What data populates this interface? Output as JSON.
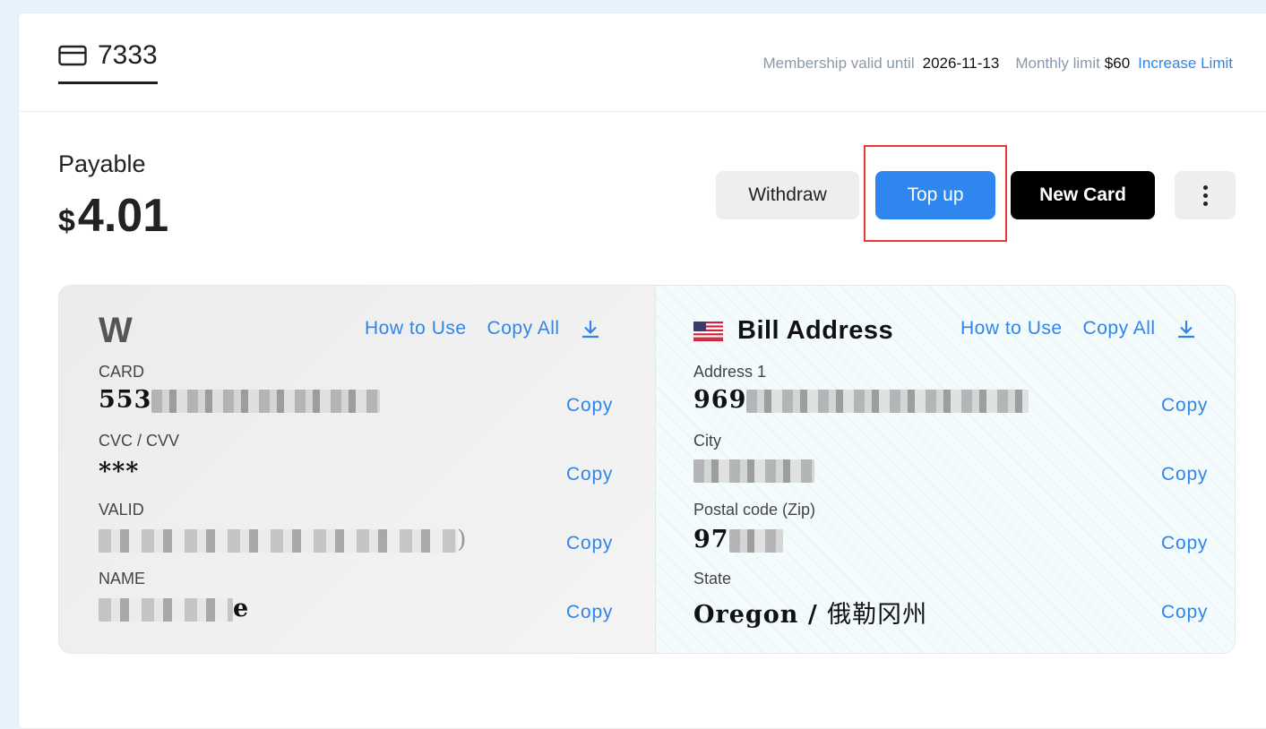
{
  "header": {
    "card_last4": "7333",
    "membership_label": "Membership valid until",
    "membership_date": "2026-11-13",
    "monthly_limit_label": "Monthly limit",
    "monthly_limit_value": "$60",
    "increase_limit_link": "Increase Limit"
  },
  "payable": {
    "label": "Payable",
    "currency": "$",
    "amount": "4.01"
  },
  "buttons": {
    "withdraw": "Withdraw",
    "top_up": "Top up",
    "new_card": "New Card"
  },
  "card_section": {
    "logo": "W",
    "how_to_use": "How to Use",
    "copy_all": "Copy All",
    "fields": [
      {
        "label": "CARD",
        "value": "553",
        "copy": "Copy"
      },
      {
        "label": "CVC / CVV",
        "value": "***",
        "copy": "Copy"
      },
      {
        "label": "VALID",
        "value": ")",
        "copy": "Copy"
      },
      {
        "label": "NAME",
        "value": "e",
        "copy": "Copy"
      }
    ]
  },
  "bill_section": {
    "title": "Bill Address",
    "how_to_use": "How to Use",
    "copy_all": "Copy All",
    "fields": [
      {
        "label": "Address 1",
        "value": "969",
        "copy": "Copy"
      },
      {
        "label": "City",
        "value": "",
        "copy": "Copy"
      },
      {
        "label": "Postal code (Zip)",
        "value": "97",
        "copy": "Copy"
      },
      {
        "label": "State",
        "value": "Oregon / ",
        "value_cjk": "俄勒冈州",
        "copy": "Copy"
      }
    ]
  },
  "colors": {
    "accent": "#2f86e8",
    "primary_button": "#2f86ee",
    "highlight_box": "#e53935"
  }
}
